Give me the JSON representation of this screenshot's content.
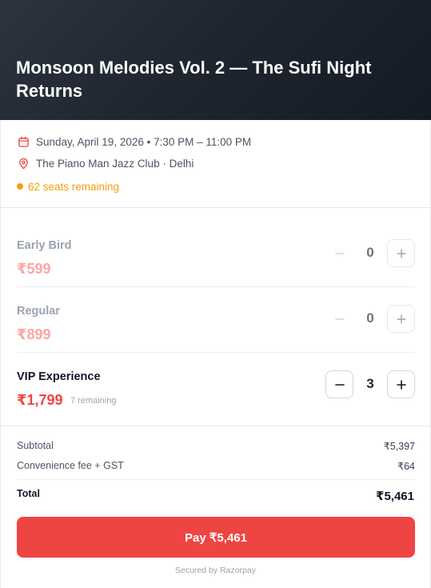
{
  "event": {
    "title": "Monsoon Melodies Vol. 2 — The Sufi Night Returns",
    "datetime": "Sunday, April 19, 2026 • 7:30 PM – 11:00 PM",
    "venue": "The Piano Man Jazz Club · Delhi",
    "seats": "62 seats remaining"
  },
  "tickets": [
    {
      "name": "Early Bird",
      "price": "₹599",
      "qty": "0",
      "remaining": ""
    },
    {
      "name": "Regular",
      "price": "₹899",
      "qty": "0",
      "remaining": ""
    },
    {
      "name": "VIP Experience",
      "price": "₹1,799",
      "qty": "3",
      "remaining": "7 remaining"
    }
  ],
  "summary": {
    "subtotal_label": "Subtotal",
    "subtotal": "₹5,397",
    "fee_label": "Convenience fee + GST",
    "fee": "₹64",
    "total_label": "Total",
    "total": "₹5,461"
  },
  "pay": {
    "label": "Pay ₹5,461",
    "secured": "Secured by Razorpay"
  },
  "icons": {
    "date": "calendar-icon",
    "venue": "map-pin-icon",
    "minus": "minus-icon",
    "plus": "plus-icon"
  },
  "colors": {
    "accent": "#ef4444",
    "warning": "#f59e0b",
    "hero": "#1f2630"
  }
}
